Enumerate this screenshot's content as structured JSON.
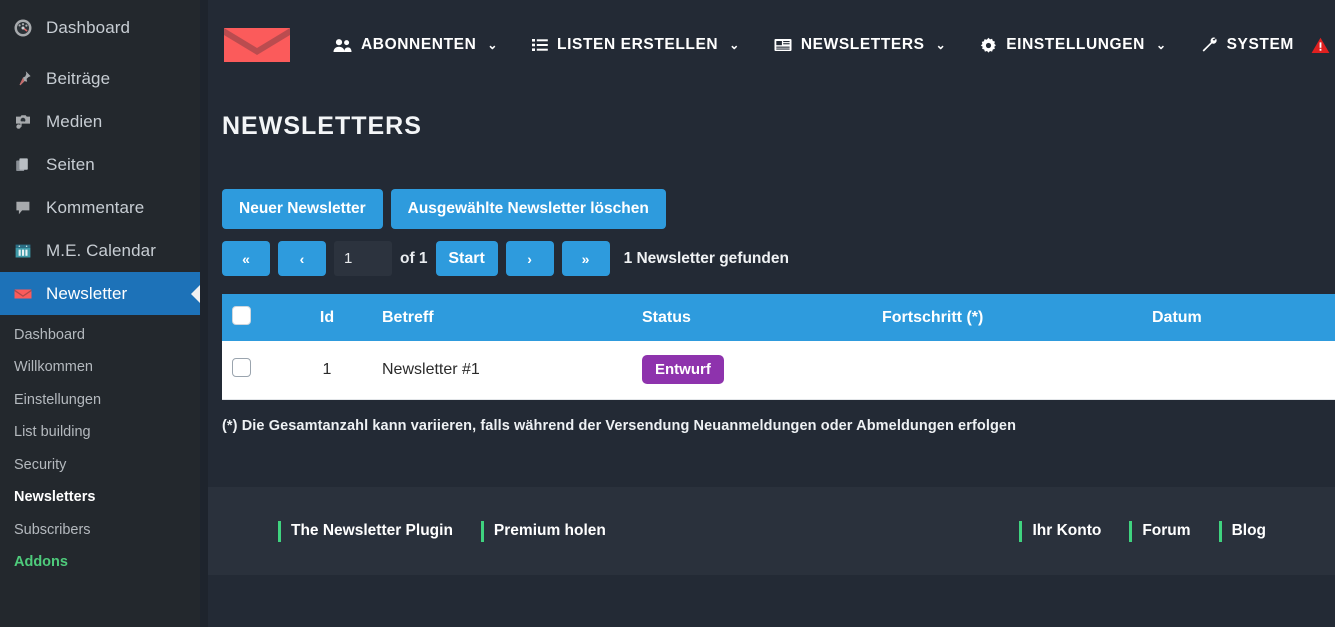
{
  "sidebar": {
    "items": [
      {
        "label": "Dashboard",
        "icon": "gauge-icon",
        "active": false
      },
      {
        "label": "Beiträge",
        "icon": "pin-icon",
        "active": false
      },
      {
        "label": "Medien",
        "icon": "media-icon",
        "active": false
      },
      {
        "label": "Seiten",
        "icon": "pages-icon",
        "active": false
      },
      {
        "label": "Kommentare",
        "icon": "comment-icon",
        "active": false
      },
      {
        "label": "M.E. Calendar",
        "icon": "calendar-icon",
        "active": false
      },
      {
        "label": "Newsletter",
        "icon": "envelope-icon",
        "active": true
      }
    ],
    "submenu": [
      {
        "label": "Dashboard",
        "state": "normal"
      },
      {
        "label": "Willkommen",
        "state": "normal"
      },
      {
        "label": "Einstellungen",
        "state": "normal"
      },
      {
        "label": "List building",
        "state": "normal"
      },
      {
        "label": "Security",
        "state": "normal"
      },
      {
        "label": "Newsletters",
        "state": "current"
      },
      {
        "label": "Subscribers",
        "state": "normal"
      },
      {
        "label": "Addons",
        "state": "addons"
      }
    ]
  },
  "topnav": {
    "logo": "newsletter-envelope-logo",
    "items": [
      {
        "label": "ABONNENTEN",
        "icon": "users-icon",
        "caret": "⌄"
      },
      {
        "label": "LISTEN ERSTELLEN",
        "icon": "list-icon",
        "caret": "⌄"
      },
      {
        "label": "NEWSLETTERS",
        "icon": "newsletter-icon",
        "caret": "⌄"
      },
      {
        "label": "EINSTELLUNGEN",
        "icon": "gear-icon",
        "caret": "⌄"
      },
      {
        "label": "SYSTEM",
        "icon": "wrench-icon",
        "caret": ""
      }
    ],
    "system_warning": "warning-triangle-icon"
  },
  "page": {
    "title": "NEWSLETTERS"
  },
  "toolbar": {
    "new_newsletter": "Neuer Newsletter",
    "delete_selected": "Ausgewählte Newsletter löschen"
  },
  "pagination": {
    "first": "«",
    "prev": "‹",
    "page_value": "1",
    "of_label": "of 1",
    "start": "Start",
    "next": "›",
    "last": "»",
    "found": "1 Newsletter gefunden"
  },
  "table": {
    "columns": [
      "",
      "Id",
      "Betreff",
      "Status",
      "Fortschritt  (*)",
      "Datum"
    ],
    "rows": [
      {
        "id": "1",
        "subject": "Newsletter #1",
        "status": "Entwurf",
        "progress": "",
        "date": ""
      }
    ]
  },
  "footnote": "(*) Die Gesamtanzahl kann variieren, falls während der Versendung Neuanmeldungen oder Abmeldungen erfolgen",
  "footer": {
    "left_links": [
      "The Newsletter Plugin",
      "Premium holen"
    ],
    "right_links": [
      "Ihr Konto",
      "Forum",
      "Blog"
    ]
  },
  "colors": {
    "accent_blue": "#2e9bdd",
    "wp_active": "#1d72b8",
    "badge_purple": "#8e33ad",
    "footer_green": "#3fd37f",
    "logo_red": "#fb5b5b",
    "warning_red": "#e02020",
    "addons_green": "#4ecb7b"
  }
}
